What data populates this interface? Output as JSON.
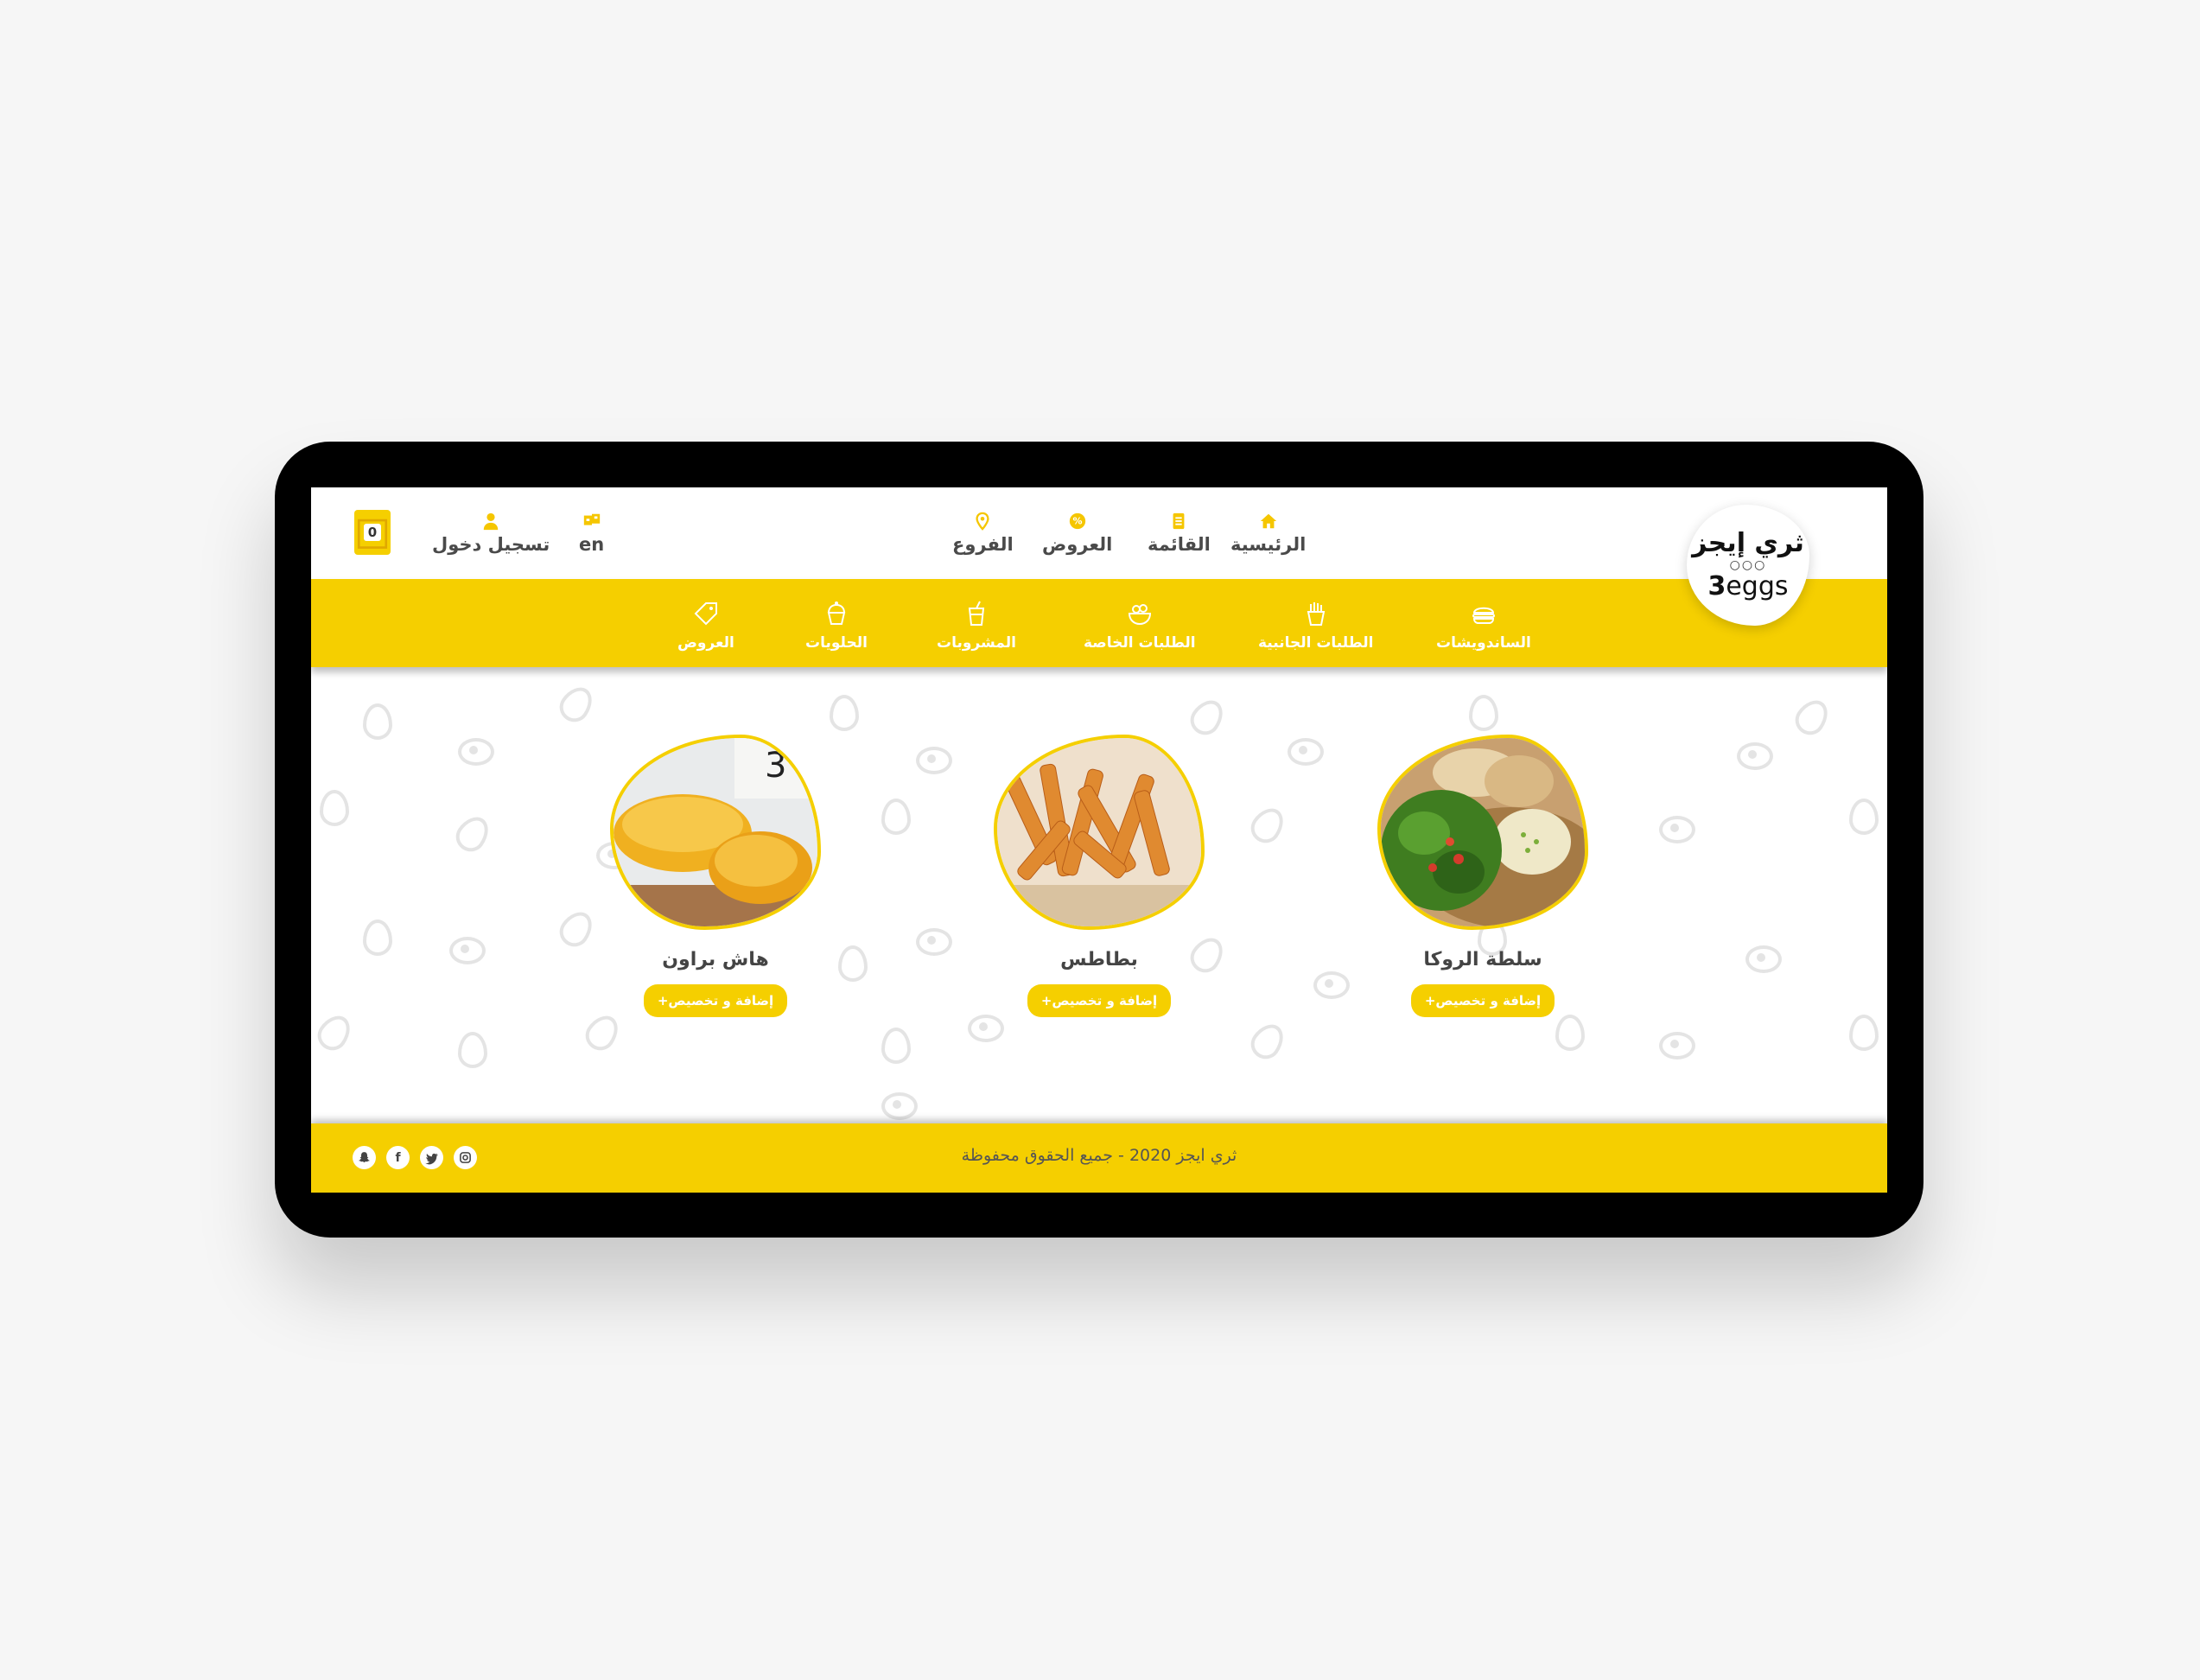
{
  "header": {
    "logo_ar": "ثري إيجز",
    "logo_dots": "○○○",
    "logo_en_bold": "3",
    "logo_en": "eggs",
    "nav": [
      {
        "label": "الرئيسية",
        "icon": "home-icon"
      },
      {
        "label": "القائمة",
        "icon": "menu-list-icon"
      },
      {
        "label": "العروض",
        "icon": "percent-icon"
      },
      {
        "label": "الفروع",
        "icon": "location-pin-icon"
      }
    ],
    "language": "en",
    "login_label": "تسجيل دخول",
    "cart_count": "0"
  },
  "categories": [
    {
      "label": "الساندويشات",
      "icon": "burger-icon"
    },
    {
      "label": "الطلبات الجانبية",
      "icon": "fries-icon"
    },
    {
      "label": "الطلبات الخاصة",
      "icon": "salad-bowl-icon"
    },
    {
      "label": "المشروبات",
      "icon": "drink-cup-icon"
    },
    {
      "label": "الحلويات",
      "icon": "dessert-icon"
    },
    {
      "label": "العروض",
      "icon": "price-tag-icon"
    }
  ],
  "products": [
    {
      "name": "سلطة الروكا",
      "button": "+إضافة و تخصيص"
    },
    {
      "name": "بطاطس",
      "button": "+إضافة و تخصيص"
    },
    {
      "name": "هاش براون",
      "button": "+إضافة و تخصيص"
    }
  ],
  "footer": {
    "copyright": "ثري ايجز 2020 - جميع الحقوق محفوظة",
    "socials": [
      "snapchat-icon",
      "facebook-icon",
      "twitter-icon",
      "instagram-icon"
    ]
  },
  "colors": {
    "accent": "#f5cf00",
    "text": "#4a4a4a",
    "device": "#000000"
  }
}
